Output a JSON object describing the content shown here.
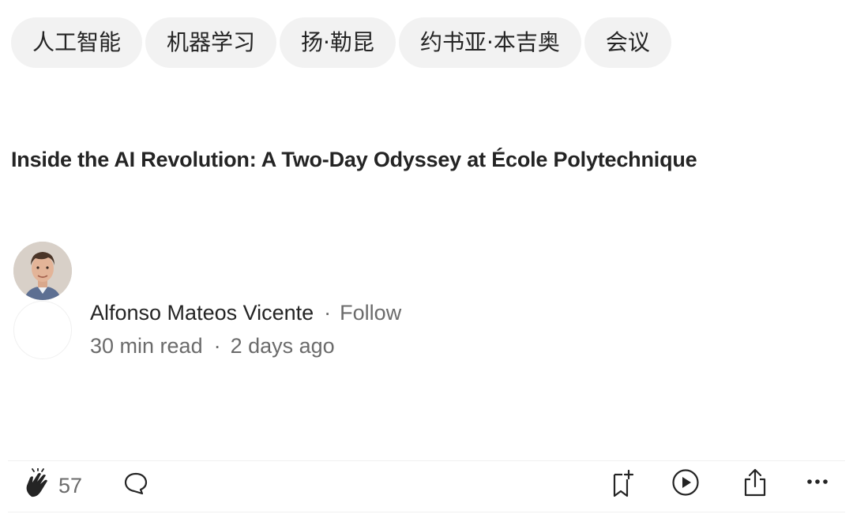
{
  "tags": [
    "人工智能",
    "机器学习",
    "扬·勒昆",
    "约书亚·本吉奥",
    "会议"
  ],
  "article": {
    "title": "Inside the AI Revolution: A Two-Day Odyssey at École Polytechnique"
  },
  "author": {
    "name": "Alfonso Mateos Vicente",
    "separator": "·",
    "follow_label": "Follow"
  },
  "meta": {
    "read_time": "30 min read",
    "separator": "·",
    "published": "2 days ago"
  },
  "actions": {
    "clap_count": "57",
    "icons": [
      "clap-icon",
      "comment-icon",
      "bookmark-add-icon",
      "play-icon",
      "share-icon",
      "more-icon"
    ]
  }
}
